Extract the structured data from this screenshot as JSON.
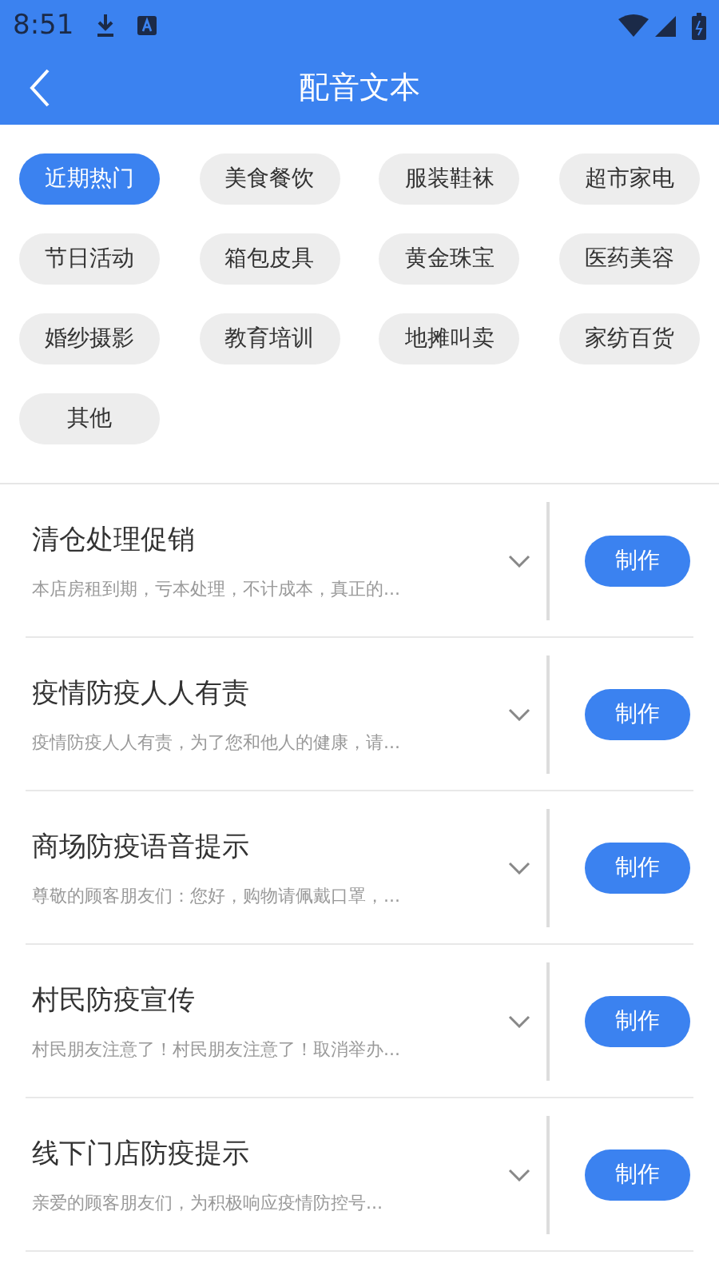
{
  "status_bar": {
    "time": "8:51"
  },
  "header": {
    "title": "配音文本"
  },
  "categories": [
    {
      "label": "近期热门",
      "selected": true
    },
    {
      "label": "美食餐饮",
      "selected": false
    },
    {
      "label": "服装鞋袜",
      "selected": false
    },
    {
      "label": "超市家电",
      "selected": false
    },
    {
      "label": "节日活动",
      "selected": false
    },
    {
      "label": "箱包皮具",
      "selected": false
    },
    {
      "label": "黄金珠宝",
      "selected": false
    },
    {
      "label": "医药美容",
      "selected": false
    },
    {
      "label": "婚纱摄影",
      "selected": false
    },
    {
      "label": "教育培训",
      "selected": false
    },
    {
      "label": "地摊叫卖",
      "selected": false
    },
    {
      "label": "家纺百货",
      "selected": false
    },
    {
      "label": "其他",
      "selected": false
    }
  ],
  "scripts": [
    {
      "title": "清仓处理促销",
      "preview": "本店房租到期，亏本处理，不计成本，真正的...",
      "button": "制作"
    },
    {
      "title": "疫情防疫人人有责",
      "preview": "疫情防疫人人有责，为了您和他人的健康，请...",
      "button": "制作"
    },
    {
      "title": "商场防疫语音提示",
      "preview": "尊敬的顾客朋友们：您好，购物请佩戴口罩，...",
      "button": "制作"
    },
    {
      "title": "村民防疫宣传",
      "preview": "村民朋友注意了！村民朋友注意了！取消举办...",
      "button": "制作"
    },
    {
      "title": "线下门店防疫提示",
      "preview": "亲爱的顾客朋友们，为积极响应疫情防控号...",
      "button": "制作"
    }
  ]
}
